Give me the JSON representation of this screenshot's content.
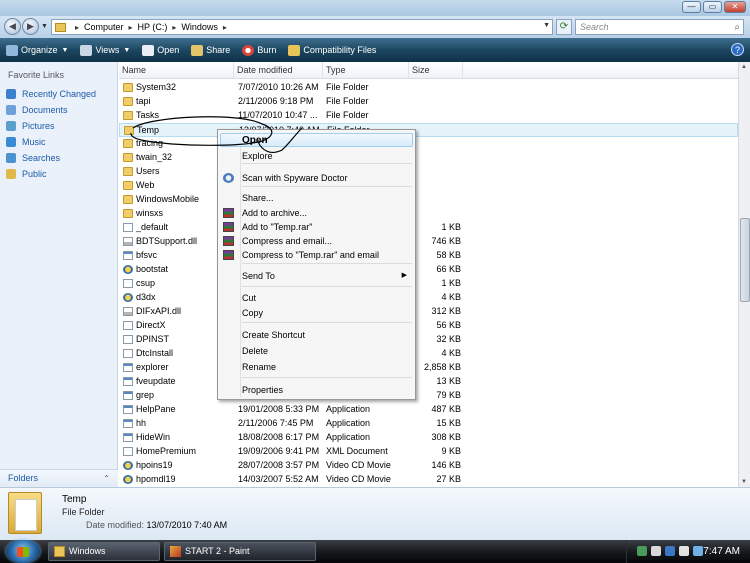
{
  "window": {
    "minimize_label": "—",
    "maximize_label": "▭",
    "close_label": "✕",
    "accent": "#c23f2f"
  },
  "address": {
    "segments": [
      "Computer",
      "HP (C:)",
      "Windows"
    ],
    "separator": "▸",
    "search_placeholder": "Search"
  },
  "toolbar": {
    "items": [
      {
        "label": "Organize",
        "icon": "organize-icon",
        "dropdown": true
      },
      {
        "label": "Views",
        "icon": "views-icon",
        "dropdown": true
      },
      {
        "label": "Open",
        "icon": "open-icon",
        "dropdown": false
      },
      {
        "label": "Share",
        "icon": "share-icon",
        "dropdown": false
      },
      {
        "label": "Burn",
        "icon": "burn-icon",
        "dropdown": false
      },
      {
        "label": "Compatibility Files",
        "icon": "folder-icon",
        "dropdown": false
      }
    ],
    "help_label": "?"
  },
  "sidebar": {
    "heading": "Favorite Links",
    "items": [
      {
        "label": "Recently Changed",
        "color": "#3c7fd1"
      },
      {
        "label": "Documents",
        "color": "#6d9fd8"
      },
      {
        "label": "Pictures",
        "color": "#5aa0cf"
      },
      {
        "label": "Music",
        "color": "#3a8bd4"
      },
      {
        "label": "Searches",
        "color": "#4a93d0"
      },
      {
        "label": "Public",
        "color": "#e0b94a"
      }
    ],
    "folders_label": "Folders",
    "folders_chevron": "⌃"
  },
  "columns": {
    "name": "Name",
    "date": "Date modified",
    "type": "Type",
    "size": "Size"
  },
  "files": [
    {
      "name": "System32",
      "date": "7/07/2010 10:26 AM",
      "type": "File Folder",
      "size": "",
      "icon": "folder"
    },
    {
      "name": "tapi",
      "date": "2/11/2006 9:18 PM",
      "type": "File Folder",
      "size": "",
      "icon": "folder"
    },
    {
      "name": "Tasks",
      "date": "11/07/2010 10:47 ...",
      "type": "File Folder",
      "size": "",
      "icon": "folder"
    },
    {
      "name": "Temp",
      "date": "13/07/2010 7:40 AM",
      "type": "File Folder",
      "size": "",
      "icon": "folder",
      "selected": true
    },
    {
      "name": "tracing",
      "date": "",
      "type": "",
      "size": "",
      "icon": "folder"
    },
    {
      "name": "twain_32",
      "date": "",
      "type": "",
      "size": "",
      "icon": "folder"
    },
    {
      "name": "Users",
      "date": "",
      "type": "",
      "size": "",
      "icon": "folder"
    },
    {
      "name": "Web",
      "date": "",
      "type": "",
      "size": "",
      "icon": "folder"
    },
    {
      "name": "WindowsMobile",
      "date": "",
      "type": "",
      "size": "",
      "icon": "folder"
    },
    {
      "name": "winsxs",
      "date": "",
      "type": "",
      "size": "",
      "icon": "folder"
    },
    {
      "name": "_default",
      "date": "",
      "type": "",
      "size": "1 KB",
      "icon": "file"
    },
    {
      "name": "BDTSupport.dll",
      "date": "",
      "type": "",
      "size": "746 KB",
      "icon": "dll"
    },
    {
      "name": "bfsvc",
      "date": "",
      "type": "",
      "size": "58 KB",
      "icon": "app"
    },
    {
      "name": "bootstat",
      "date": "",
      "type": "",
      "size": "66 KB",
      "icon": "movie"
    },
    {
      "name": "csup",
      "date": "",
      "type": "",
      "size": "1 KB",
      "icon": "file"
    },
    {
      "name": "d3dx",
      "date": "",
      "type": "",
      "size": "4 KB",
      "icon": "movie"
    },
    {
      "name": "DIFxAPI.dll",
      "date": "",
      "type": "",
      "size": "312 KB",
      "icon": "dll"
    },
    {
      "name": "DirectX",
      "date": "",
      "type": "",
      "size": "56 KB",
      "icon": "file"
    },
    {
      "name": "DPINST",
      "date": "",
      "type": "",
      "size": "32 KB",
      "icon": "file"
    },
    {
      "name": "DtcInstall",
      "date": "",
      "type": "",
      "size": "4 KB",
      "icon": "file"
    },
    {
      "name": "explorer",
      "date": "",
      "type": "",
      "size": "2,858 KB",
      "icon": "app"
    },
    {
      "name": "fveupdate",
      "date": "",
      "type": "",
      "size": "13 KB",
      "icon": "app"
    },
    {
      "name": "grep",
      "date": "",
      "type": "",
      "size": "79 KB",
      "icon": "app"
    },
    {
      "name": "HelpPane",
      "date": "19/01/2008 5:33 PM",
      "type": "Application",
      "size": "487 KB",
      "icon": "app"
    },
    {
      "name": "hh",
      "date": "2/11/2006 7:45 PM",
      "type": "Application",
      "size": "15 KB",
      "icon": "app"
    },
    {
      "name": "HideWin",
      "date": "18/08/2008 6:17 PM",
      "type": "Application",
      "size": "308 KB",
      "icon": "app"
    },
    {
      "name": "HomePremium",
      "date": "19/09/2006 9:41 PM",
      "type": "XML Document",
      "size": "9 KB",
      "icon": "file"
    },
    {
      "name": "hpoins19",
      "date": "28/07/2008 3:57 PM",
      "type": "Video CD Movie",
      "size": "146 KB",
      "icon": "movie"
    },
    {
      "name": "hpomdl19",
      "date": "14/03/2007 5:52 AM",
      "type": "Video CD Movie",
      "size": "27 KB",
      "icon": "movie"
    }
  ],
  "context_menu": {
    "items": [
      {
        "label": "Open",
        "bold": true,
        "highlighted": true
      },
      {
        "label": "Explore"
      },
      {
        "sep": true
      },
      {
        "label": "Scan with Spyware Doctor",
        "icon": "spyware-doctor-icon"
      },
      {
        "sep": true
      },
      {
        "label": "Share..."
      },
      {
        "label": "Add to archive...",
        "icon": "winrar-icon"
      },
      {
        "label": "Add to \"Temp.rar\"",
        "icon": "winrar-icon"
      },
      {
        "label": "Compress and email...",
        "icon": "winrar-icon"
      },
      {
        "label": "Compress to \"Temp.rar\" and email",
        "icon": "winrar-icon"
      },
      {
        "sep": true
      },
      {
        "label": "Send To",
        "submenu": true
      },
      {
        "sep": true
      },
      {
        "label": "Cut"
      },
      {
        "label": "Copy"
      },
      {
        "sep": true
      },
      {
        "label": "Create Shortcut"
      },
      {
        "label": "Delete"
      },
      {
        "label": "Rename"
      },
      {
        "sep": true
      },
      {
        "label": "Properties"
      }
    ],
    "submenu_arrow": "▶"
  },
  "details": {
    "name": "Temp",
    "type": "File Folder",
    "modified_label": "Date modified:",
    "modified_value": "13/07/2010 7:40 AM"
  },
  "taskbar": {
    "tasks": [
      {
        "label": "Windows",
        "icon": "folder-icon"
      },
      {
        "label": "START 2 - Paint",
        "icon": "paint-icon"
      }
    ],
    "clock": "7:47 AM"
  }
}
